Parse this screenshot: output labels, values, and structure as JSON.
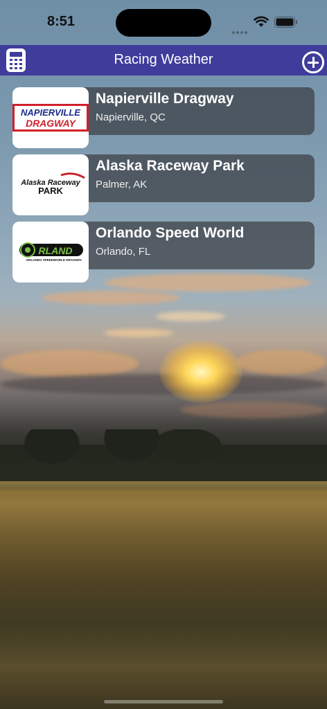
{
  "status_bar": {
    "time": "8:51"
  },
  "nav": {
    "title": "Racing Weather",
    "left_icon": "calculator-icon",
    "right_icon": "add-circle-icon"
  },
  "tracks": [
    {
      "name": "Napierville Dragway",
      "location": "Napierville, QC",
      "logo_text": [
        "NAPIERVILLE",
        "DRAGWAY"
      ]
    },
    {
      "name": "Alaska Raceway Park",
      "location": "Palmer, AK",
      "logo_text": [
        "Alaska Raceway",
        "PARK"
      ]
    },
    {
      "name": "Orlando Speed World",
      "location": "Orlando, FL",
      "logo_text": [
        "RLAND",
        "ORLANDO SPEEDWORLD DRAGWAY"
      ]
    }
  ],
  "colors": {
    "nav_bar": "#3f3c9c",
    "card_overlay": "#3c3e44",
    "napierville_red": "#d0202a"
  }
}
